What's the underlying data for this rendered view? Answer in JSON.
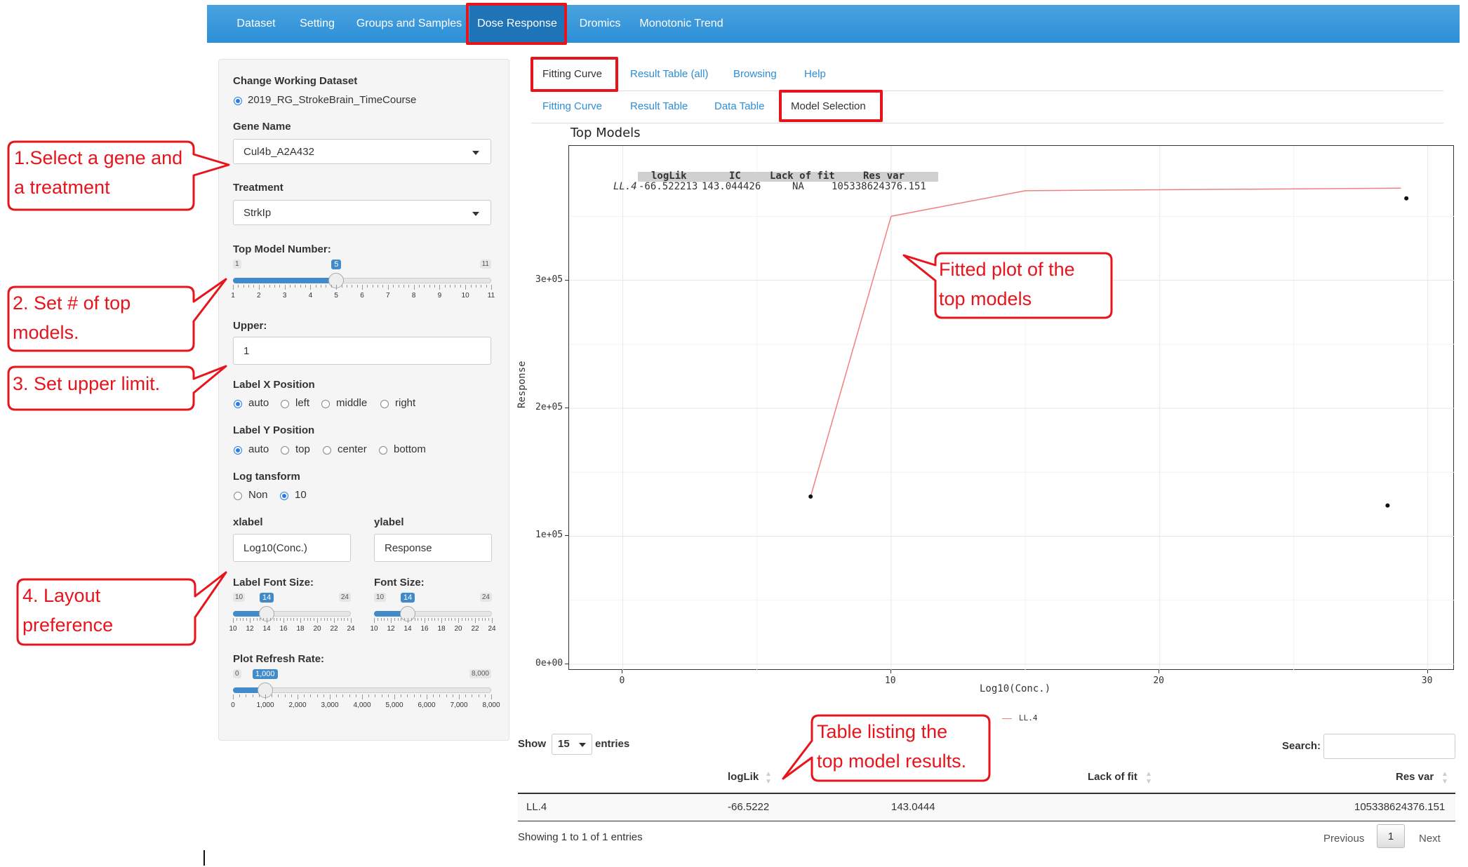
{
  "nav": {
    "items": [
      "Dataset",
      "Setting",
      "Groups and Samples",
      "Dose Response",
      "Dromics",
      "Monotonic Trend"
    ],
    "active": "Dose Response"
  },
  "sidebar": {
    "working_dataset_label": "Change Working Dataset",
    "working_dataset_value": "2019_RG_StrokeBrain_TimeCourse",
    "gene_name_label": "Gene Name",
    "gene_name_value": "Cul4b_A2A432",
    "treatment_label": "Treatment",
    "treatment_value": "StrkIp",
    "top_model_label": "Top Model Number:",
    "top_model": {
      "min": "1",
      "max": "11",
      "value": "5",
      "value_num": 5,
      "min_num": 1,
      "max_num": 11,
      "ticks": [
        "1",
        "2",
        "3",
        "4",
        "5",
        "6",
        "7",
        "8",
        "9",
        "10",
        "11"
      ]
    },
    "upper_label": "Upper:",
    "upper_value": "1",
    "label_x_label": "Label X Position",
    "label_x_options": [
      "auto",
      "left",
      "middle",
      "right"
    ],
    "label_x_selected": "auto",
    "label_y_label": "Label Y Position",
    "label_y_options": [
      "auto",
      "top",
      "center",
      "bottom"
    ],
    "label_y_selected": "auto",
    "log_label": "Log tansform",
    "log_options": [
      "Non",
      "10"
    ],
    "log_selected": "10",
    "xlabel_label": "xlabel",
    "xlabel_value": "Log10(Conc.)",
    "ylabel_label": "ylabel",
    "ylabel_value": "Response",
    "label_font_label": "Label Font Size:",
    "label_font": {
      "min": "10",
      "max": "24",
      "value": "14",
      "value_num": 14,
      "min_num": 10,
      "max_num": 24,
      "ticks": [
        "10",
        "12",
        "14",
        "16",
        "18",
        "20",
        "22",
        "24"
      ]
    },
    "font_label": "Font Size:",
    "font": {
      "min": "10",
      "max": "24",
      "value": "14",
      "value_num": 14,
      "min_num": 10,
      "max_num": 24,
      "ticks": [
        "10",
        "12",
        "14",
        "16",
        "18",
        "20",
        "22",
        "24"
      ]
    },
    "refresh_label": "Plot Refresh Rate:",
    "refresh": {
      "min": "0",
      "max": "8,000",
      "value": "1,000",
      "value_num": 1000,
      "min_num": 0,
      "max_num": 8000,
      "ticks": [
        "0",
        "1,000",
        "2,000",
        "3,000",
        "4,000",
        "5,000",
        "6,000",
        "7,000",
        "8,000"
      ]
    }
  },
  "tabs": {
    "row1": [
      "Fitting Curve",
      "Result Table (all)",
      "Browsing",
      "Help"
    ],
    "row1_active": "Fitting Curve",
    "row2": [
      "Fitting Curve",
      "Result Table",
      "Data Table",
      "Model Selection"
    ],
    "row2_active": "Model Selection"
  },
  "chart_data": {
    "type": "line",
    "title": "Top Models",
    "xlabel": "Log10(Conc.)",
    "ylabel": "Response",
    "xlim": [
      -2,
      31
    ],
    "ylim": [
      -5000,
      405000
    ],
    "x_ticks": [
      "0",
      "10",
      "20",
      "30"
    ],
    "y_ticks": [
      "0e+00",
      "1e+05",
      "2e+05",
      "3e+05"
    ],
    "series": [
      {
        "name": "LL.4",
        "x": [
          7,
          10,
          15,
          29
        ],
        "y": [
          131000,
          350000,
          370000,
          372000
        ]
      }
    ],
    "points": [
      {
        "x": 7,
        "y": 131000
      },
      {
        "x": 28.5,
        "y": 124000
      },
      {
        "x": 29.2,
        "y": 364000
      }
    ],
    "legend": [
      "LL.4"
    ],
    "inset_table": {
      "headers": [
        "logLik",
        "IC",
        "Lack of fit",
        "Res var"
      ],
      "row_name": "LL.4",
      "values": [
        "-66.522213",
        "143.044426",
        "NA",
        "105338624376.151"
      ]
    },
    "color": "#f08080"
  },
  "table": {
    "show_label": "Show",
    "entries_value": "15",
    "entries_label": "entries",
    "search_label": "Search:",
    "headers": [
      "logLik",
      "Lack of fit",
      "Res var"
    ],
    "rows": [
      {
        "name": "LL.4",
        "loglik": "-66.5222",
        "ic": "143.0444",
        "resvar": "105338624376.151"
      }
    ],
    "info": "Showing 1 to 1 of 1 entries",
    "previous": "Previous",
    "page": "1",
    "next": "Next"
  },
  "callouts": {
    "c1": [
      "1.Select a gene and",
      "a treatment"
    ],
    "c2": [
      "2. Set # of top",
      "models."
    ],
    "c3": [
      "3. Set upper limit."
    ],
    "c4": [
      "4. Layout",
      "preference"
    ],
    "c5": [
      "Fitted plot of the",
      "top models"
    ],
    "c6": [
      "Table listing the",
      "top model results."
    ]
  }
}
